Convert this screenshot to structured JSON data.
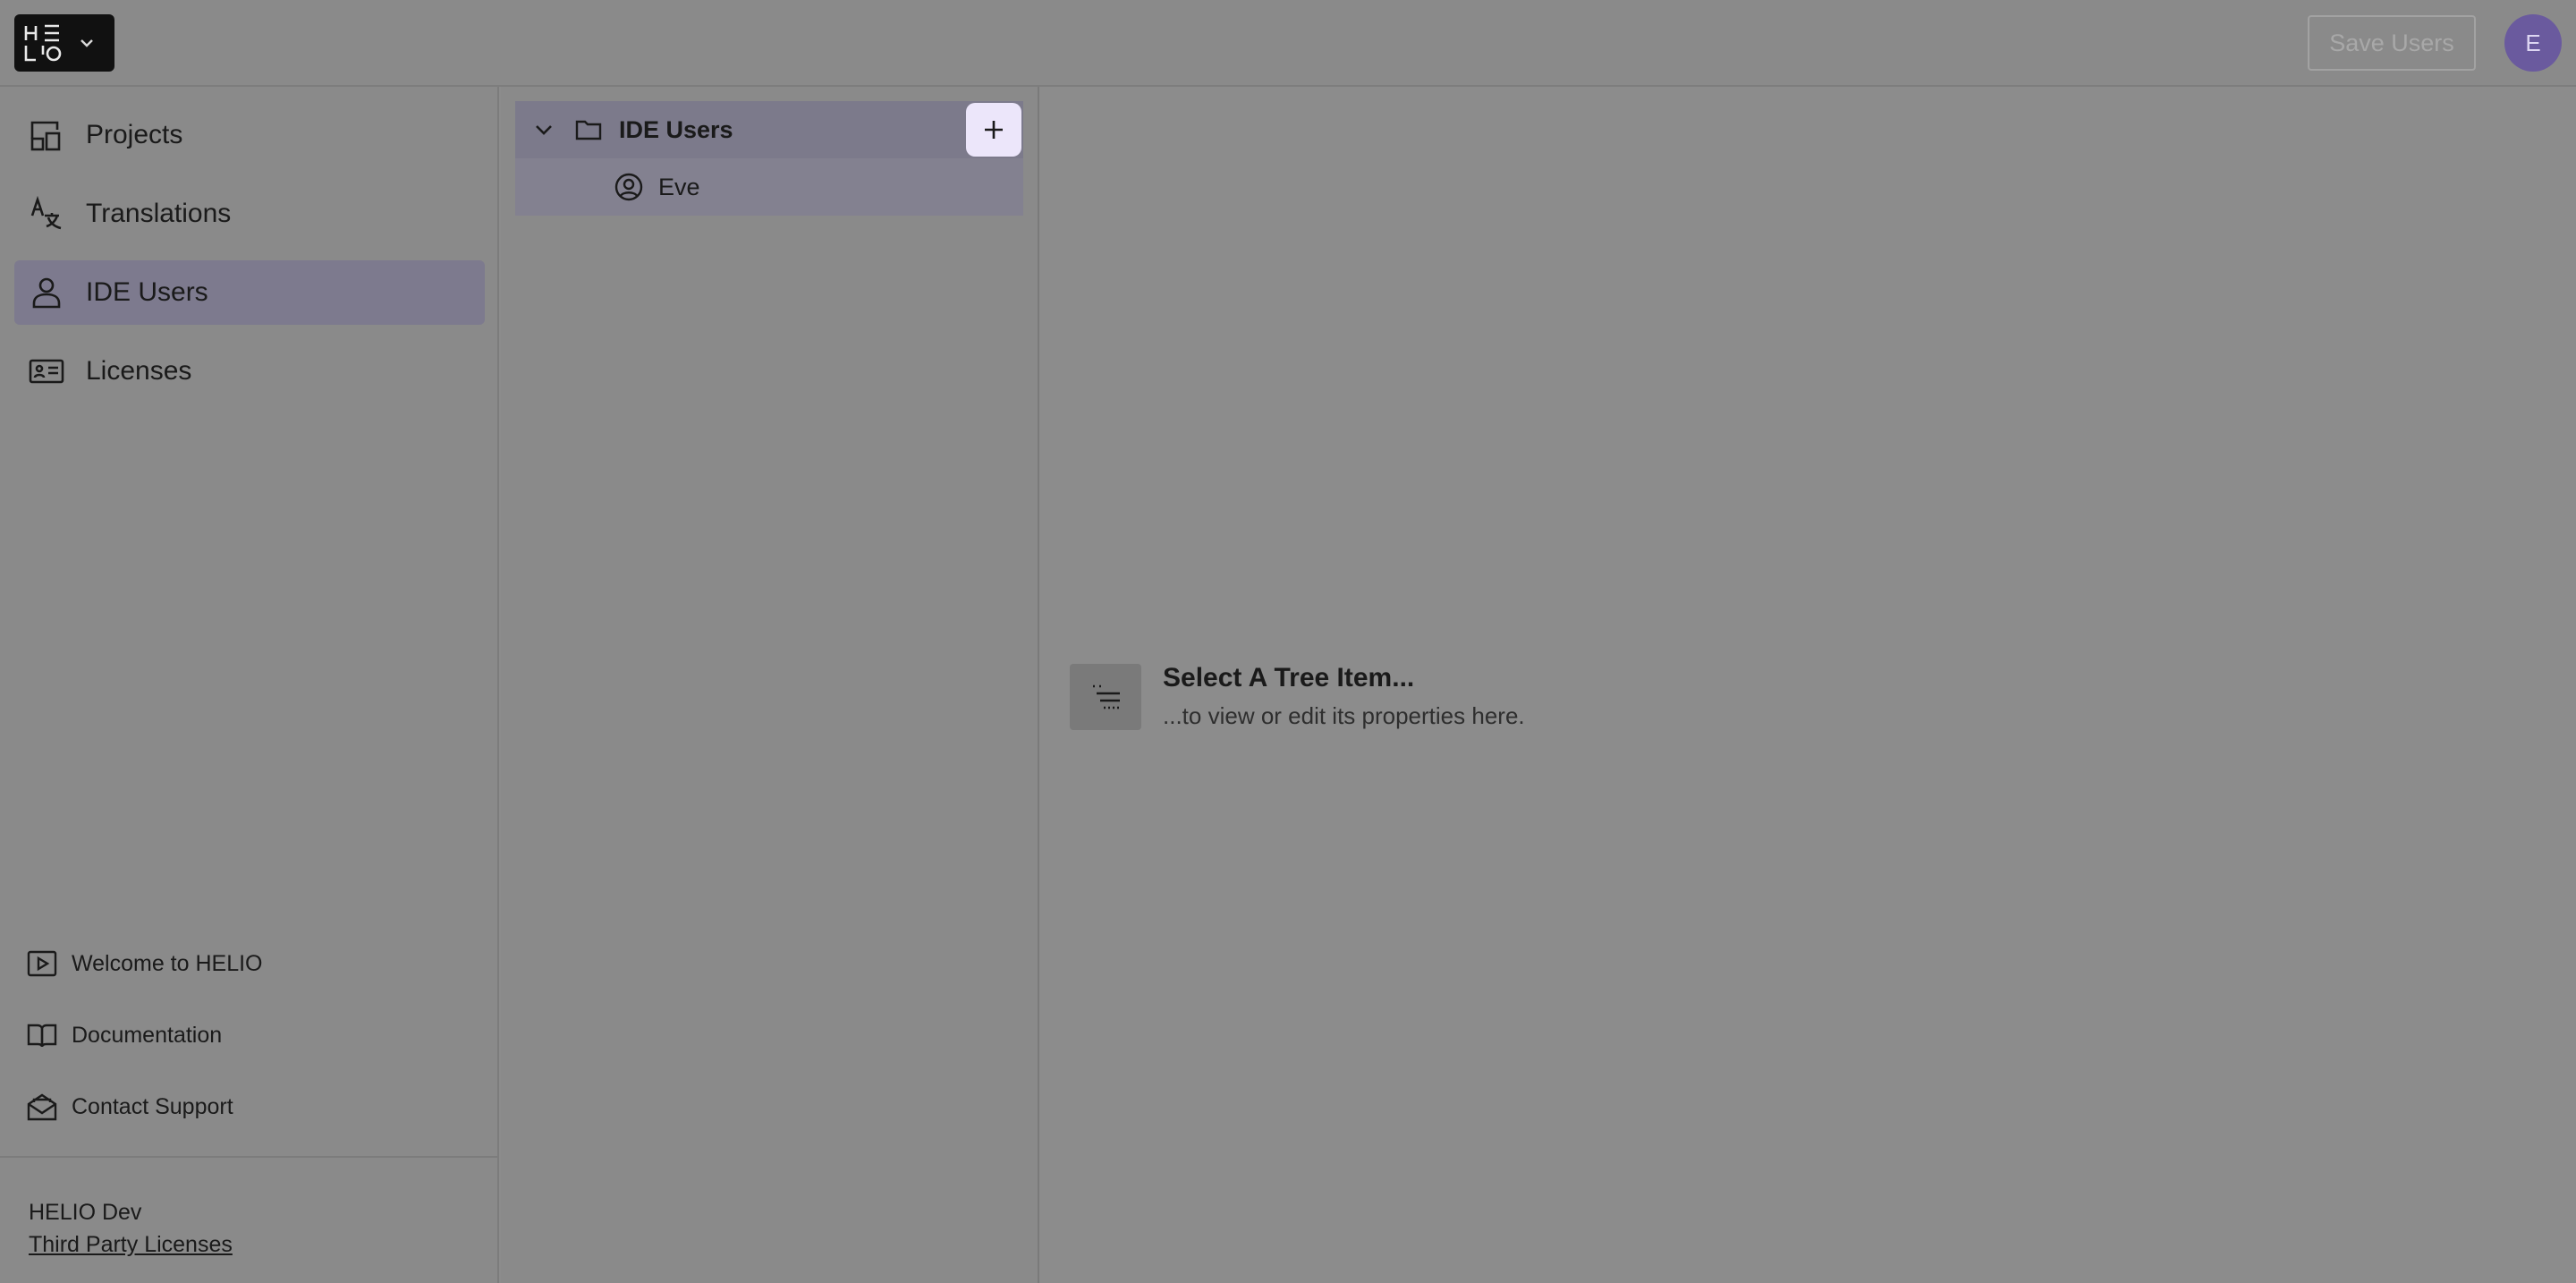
{
  "app": {
    "logo_text": "HELIO",
    "save_label": "Save Users",
    "avatar_initial": "E"
  },
  "sidebar": {
    "items": [
      {
        "label": "Projects",
        "icon": "projects-icon"
      },
      {
        "label": "Translations",
        "icon": "translate-icon"
      },
      {
        "label": "IDE Users",
        "icon": "user-icon",
        "active": true
      },
      {
        "label": "Licenses",
        "icon": "id-card-icon"
      }
    ],
    "footer": [
      {
        "label": "Welcome to HELIO",
        "icon": "play-icon"
      },
      {
        "label": "Documentation",
        "icon": "book-icon"
      },
      {
        "label": "Contact Support",
        "icon": "mail-icon"
      }
    ],
    "env_label": "HELIO Dev",
    "licenses_link": "Third Party Licenses"
  },
  "tree": {
    "root_label": "IDE Users",
    "children": [
      {
        "label": "Eve",
        "icon": "user-circle-icon"
      }
    ]
  },
  "main": {
    "empty_title": "Select A Tree Item...",
    "empty_subtitle": "...to view or edit its properties here."
  },
  "colors": {
    "active_bg": "#7d7a8e",
    "add_button_bg": "#ece6fa",
    "avatar_bg": "#6a5a9e"
  }
}
